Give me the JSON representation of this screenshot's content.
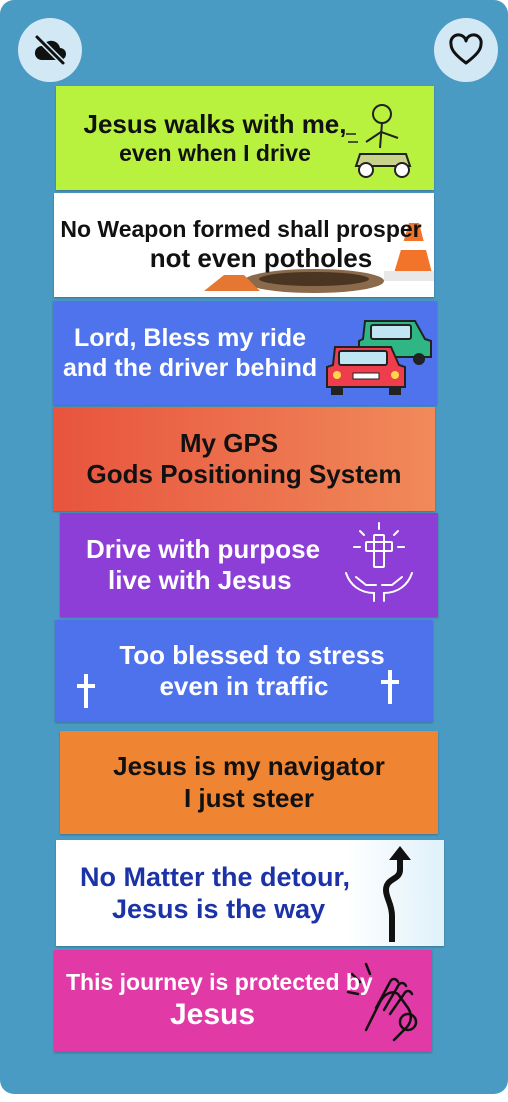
{
  "colors": {
    "background": "#4a9bc4",
    "button_bg": "#d2e9f5"
  },
  "buttons": {
    "hide": {
      "icon": "eye-slash-cloud-icon"
    },
    "favorite": {
      "icon": "heart-outline-icon"
    }
  },
  "stickers": [
    {
      "id": "walks",
      "bg": "#b9f23e",
      "text_color": "#111111",
      "lines": [
        "Jesus walks with me,",
        "even when I drive"
      ],
      "icon": "stick-figure-driving-car-icon"
    },
    {
      "id": "weapon",
      "bg": "#ffffff",
      "text_color": "#111111",
      "lines": [
        "No Weapon formed shall prosper",
        "not even potholes"
      ],
      "icon": "traffic-cone-pothole-icon"
    },
    {
      "id": "bless",
      "bg": "#4f73ec",
      "text_color": "#ffffff",
      "lines": [
        "Lord, Bless my ride",
        "and the driver behind"
      ],
      "icon": "two-cars-icon"
    },
    {
      "id": "gps",
      "bg": "#e9704d",
      "text_color": "#111111",
      "lines": [
        "My GPS",
        "Gods Positioning System"
      ],
      "icon": ""
    },
    {
      "id": "purpose",
      "bg": "#8d3ed6",
      "text_color": "#ffffff",
      "lines": [
        "Drive with purpose",
        "live with Jesus"
      ],
      "icon": "hands-holding-cross-icon"
    },
    {
      "id": "stress",
      "bg": "#4e72ec",
      "text_color": "#ffffff",
      "lines": [
        "Too blessed to stress",
        "even in traffic"
      ],
      "icon": "cross-icon"
    },
    {
      "id": "navigator",
      "bg": "#ef8533",
      "text_color": "#111111",
      "lines": [
        "Jesus is my navigator",
        "I just steer"
      ],
      "icon": ""
    },
    {
      "id": "detour",
      "bg": "#ffffff",
      "text_color": "#1c33a8",
      "lines": [
        "No Matter the detour,",
        "Jesus is the way"
      ],
      "icon": "winding-road-arrow-icon"
    },
    {
      "id": "protected",
      "bg": "#e13aa6",
      "text_color": "#ffffff",
      "lines": [
        "This journey is protected by",
        "Jesus"
      ],
      "icon": "praying-hands-icon"
    }
  ]
}
